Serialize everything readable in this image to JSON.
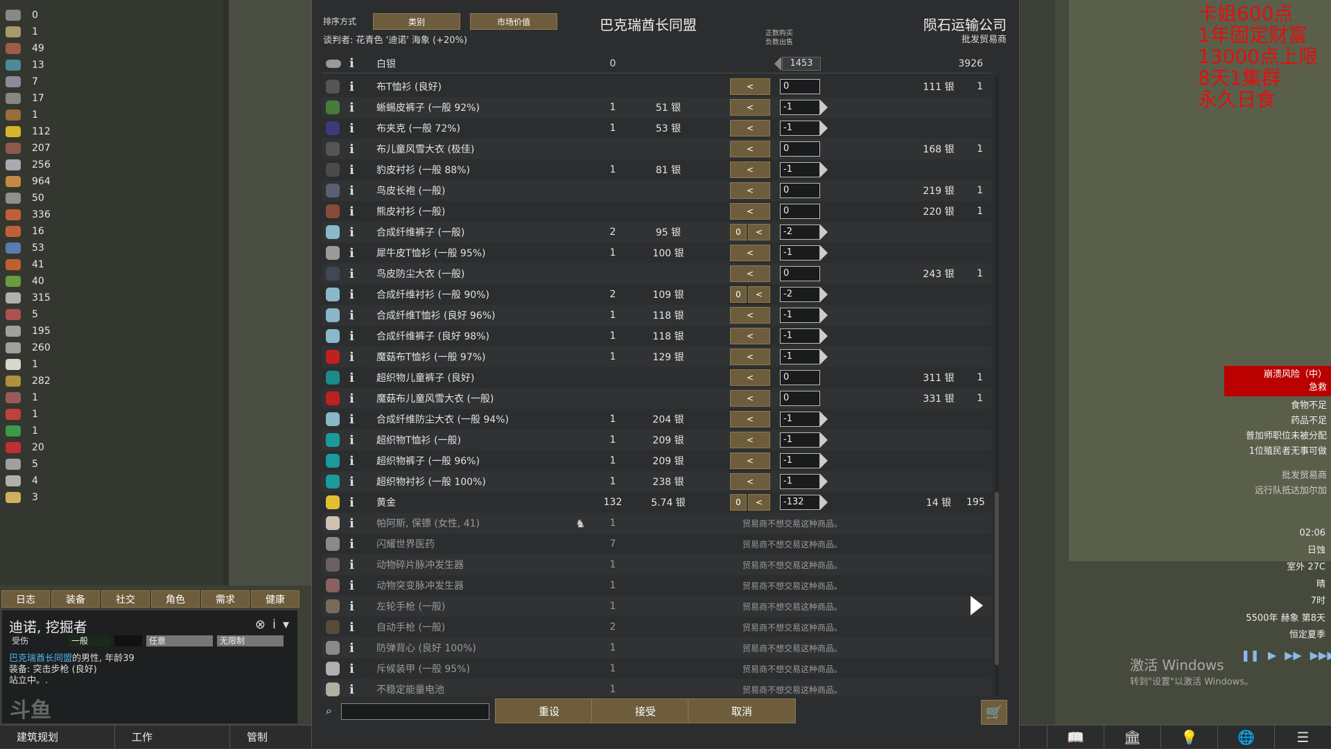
{
  "colors": {
    "accent_button": "#6e5d3c",
    "stream_red": "#e01010",
    "alert_red": "#bb0000",
    "faction_link": "#4fb3e8"
  },
  "resources": [
    {
      "count": "0",
      "color": "#888"
    },
    {
      "count": "1",
      "color": "#a79a6b"
    },
    {
      "count": "49",
      "color": "#9d5b4a"
    },
    {
      "count": "13",
      "color": "#4c8a9b"
    },
    {
      "count": "7",
      "color": "#8b8b9a"
    },
    {
      "count": "17",
      "color": "#8a8580"
    },
    {
      "count": "1",
      "color": "#9a6b3c"
    },
    {
      "count": "112",
      "color": "#d6b42c"
    },
    {
      "count": "207",
      "color": "#8b5a4a"
    },
    {
      "count": "256",
      "color": "#a9a9b0"
    },
    {
      "count": "964",
      "color": "#c28a45"
    },
    {
      "count": "50",
      "color": "#8f8f8f"
    },
    {
      "count": "336",
      "color": "#c0603a"
    },
    {
      "count": "16",
      "color": "#c0603a"
    },
    {
      "count": "53",
      "color": "#5a7ab0"
    },
    {
      "count": "41",
      "color": "#c06030"
    },
    {
      "count": "40",
      "color": "#6a9a40"
    },
    {
      "count": "315",
      "color": "#b0b0b0"
    },
    {
      "count": "5",
      "color": "#b05050"
    },
    {
      "count": "195",
      "color": "#a0a0a0"
    },
    {
      "count": "260",
      "color": "#a0a0a0"
    },
    {
      "count": "1",
      "color": "#d8d8c8"
    },
    {
      "count": "282",
      "color": "#b09040"
    },
    {
      "count": "1",
      "color": "#9a5a5a"
    },
    {
      "count": "1",
      "color": "#c04040"
    },
    {
      "count": "1",
      "color": "#3a9a4a"
    },
    {
      "count": "20",
      "color": "#c03030"
    },
    {
      "count": "5",
      "color": "#a0a0a0"
    },
    {
      "count": "4",
      "color": "#b0b0b0"
    },
    {
      "count": "3",
      "color": "#d0b060"
    }
  ],
  "tabs": [
    "日志",
    "装备",
    "社交",
    "角色",
    "需求",
    "健康"
  ],
  "inspect": {
    "name": "迪诺, 挖掘者",
    "bars": [
      "受伤",
      "一般",
      "任意",
      "无限制"
    ],
    "faction": "巴克瑞酋长同盟",
    "desc_rest": "的男性, 年龄39",
    "equip": "装备: 突击步枪 (良好)",
    "status": "站立中。."
  },
  "logo": "斗鱼",
  "bottombar": {
    "architect": "建筑规划",
    "work": "工作",
    "restrict": "管制"
  },
  "stream_text": [
    "卡姐600点",
    "1年固定财富",
    "13000点上限",
    "8天1集群",
    "永久日食"
  ],
  "alerts": {
    "red": [
      "崩溃风险（中）",
      "急救"
    ],
    "list": [
      "食物不足",
      "药品不足",
      "普加师职位未被分配",
      "1位殖民者无事可做"
    ],
    "list2": [
      "批发贸易商",
      "远行队抵达加尔加"
    ]
  },
  "time": [
    "02:06",
    "日蚀",
    "室外 27C",
    "晴",
    "7时",
    "5500年 赫象 第8天",
    "恒定夏季"
  ],
  "windows_activation": {
    "line1": "激活 Windows",
    "line2": "转到\"设置\"以激活 Windows。"
  },
  "trade": {
    "sort_label": "排序方式",
    "sort_buttons": [
      "类别",
      "市场价值"
    ],
    "negotiator": "谈判者: 花青色 '迪诺' 海象 (+20%)",
    "faction_title": "巴克瑞酋长同盟",
    "trader_title": "陨石运输公司",
    "trader_subtitle": "批发贸易商",
    "buy_sell_hint": [
      "正数购买",
      "负数出售"
    ],
    "silver": {
      "name": "白银",
      "count": "0",
      "balance": "1453",
      "trader_count": "3926"
    },
    "rows": [
      {
        "name": "布T恤衫 (良好)",
        "count": "",
        "price": "",
        "zero": false,
        "qty": "0",
        "arrow": false,
        "tprice": "111 银",
        "tcnt": "1",
        "color": "#555"
      },
      {
        "name": "蜥蜴皮裤子 (一般 92%)",
        "count": "1",
        "price": "51 银",
        "zero": false,
        "qty": "-1",
        "arrow": true,
        "tprice": "",
        "tcnt": "",
        "color": "#4a7a3a"
      },
      {
        "name": "布夹克 (一般 72%)",
        "count": "1",
        "price": "53 银",
        "zero": false,
        "qty": "-1",
        "arrow": true,
        "tprice": "",
        "tcnt": "",
        "color": "#3c3a78"
      },
      {
        "name": "布儿童风雪大衣 (极佳)",
        "count": "",
        "price": "",
        "zero": false,
        "qty": "0",
        "arrow": false,
        "tprice": "168 银",
        "tcnt": "1",
        "color": "#555"
      },
      {
        "name": "豹皮衬衫 (一般 88%)",
        "count": "1",
        "price": "81 银",
        "zero": false,
        "qty": "-1",
        "arrow": true,
        "tprice": "",
        "tcnt": "",
        "color": "#4a4a4a"
      },
      {
        "name": "鸟皮长袍 (一般)",
        "count": "",
        "price": "",
        "zero": false,
        "qty": "0",
        "arrow": false,
        "tprice": "219 银",
        "tcnt": "1",
        "color": "#5a6070"
      },
      {
        "name": "熊皮衬衫 (一般)",
        "count": "",
        "price": "",
        "zero": false,
        "qty": "0",
        "arrow": false,
        "tprice": "220 银",
        "tcnt": "1",
        "color": "#8a4a3a"
      },
      {
        "name": "合成纤维裤子 (一般)",
        "count": "2",
        "price": "95 银",
        "zero": true,
        "qty": "-2",
        "arrow": true,
        "tprice": "",
        "tcnt": "",
        "color": "#8ab8c8"
      },
      {
        "name": "犀牛皮T恤衫 (一般 95%)",
        "count": "1",
        "price": "100 银",
        "zero": false,
        "qty": "-1",
        "arrow": true,
        "tprice": "",
        "tcnt": "",
        "color": "#9a9a9a"
      },
      {
        "name": "鸟皮防尘大衣 (一般)",
        "count": "",
        "price": "",
        "zero": false,
        "qty": "0",
        "arrow": false,
        "tprice": "243 银",
        "tcnt": "1",
        "color": "#404858"
      },
      {
        "name": "合成纤维衬衫 (一般 90%)",
        "count": "2",
        "price": "109 银",
        "zero": true,
        "qty": "-2",
        "arrow": true,
        "tprice": "",
        "tcnt": "",
        "color": "#8ab8c8"
      },
      {
        "name": "合成纤维T恤衫 (良好 96%)",
        "count": "1",
        "price": "118 银",
        "zero": false,
        "qty": "-1",
        "arrow": true,
        "tprice": "",
        "tcnt": "",
        "color": "#8ab8c8"
      },
      {
        "name": "合成纤维裤子 (良好 98%)",
        "count": "1",
        "price": "118 银",
        "zero": false,
        "qty": "-1",
        "arrow": true,
        "tprice": "",
        "tcnt": "",
        "color": "#8ab8c8"
      },
      {
        "name": "魔菇布T恤衫 (一般 97%)",
        "count": "1",
        "price": "129 银",
        "zero": false,
        "qty": "-1",
        "arrow": true,
        "tprice": "",
        "tcnt": "",
        "color": "#c02020"
      },
      {
        "name": "超织物儿童裤子 (良好)",
        "count": "",
        "price": "",
        "zero": false,
        "qty": "0",
        "arrow": false,
        "tprice": "311 银",
        "tcnt": "1",
        "color": "#1a8a8a"
      },
      {
        "name": "魔菇布儿童风雪大衣 (一般)",
        "count": "",
        "price": "",
        "zero": false,
        "qty": "0",
        "arrow": false,
        "tprice": "331 银",
        "tcnt": "1",
        "color": "#c02020"
      },
      {
        "name": "合成纤维防尘大衣 (一般 94%)",
        "count": "1",
        "price": "204 银",
        "zero": false,
        "qty": "-1",
        "arrow": true,
        "tprice": "",
        "tcnt": "",
        "color": "#8ab8c8"
      },
      {
        "name": "超织物T恤衫 (一般)",
        "count": "1",
        "price": "209 银",
        "zero": false,
        "qty": "-1",
        "arrow": true,
        "tprice": "",
        "tcnt": "",
        "color": "#1a9a9a"
      },
      {
        "name": "超织物裤子 (一般 96%)",
        "count": "1",
        "price": "209 银",
        "zero": false,
        "qty": "-1",
        "arrow": true,
        "tprice": "",
        "tcnt": "",
        "color": "#1a9a9a"
      },
      {
        "name": "超织物衬衫 (一般 100%)",
        "count": "1",
        "price": "238 银",
        "zero": false,
        "qty": "-1",
        "arrow": true,
        "tprice": "",
        "tcnt": "",
        "color": "#1a9a9a"
      },
      {
        "name": "黄金",
        "count": "132",
        "price": "5.74 银",
        "zero": true,
        "qty": "-132",
        "arrow": true,
        "tprice": "14 银",
        "tcnt": "195",
        "color": "#e0c030"
      }
    ],
    "untradeable": [
      {
        "name": "帕阿斯, 保镖 (女性, 41)",
        "count": "1",
        "pawn": true,
        "color": "#d0c0b0"
      },
      {
        "name": "闪耀世界医药",
        "count": "7",
        "pawn": false,
        "color": "#8a8a8a"
      },
      {
        "name": "动物碎片脉冲发生器",
        "count": "1",
        "pawn": false,
        "color": "#6a6060"
      },
      {
        "name": "动物突变脉冲发生器",
        "count": "1",
        "pawn": false,
        "color": "#8a6060"
      },
      {
        "name": "左轮手枪 (一般)",
        "count": "1",
        "pawn": false,
        "color": "#7a6a5a"
      },
      {
        "name": "自动手枪 (一般)",
        "count": "2",
        "pawn": false,
        "color": "#5a4a3a"
      },
      {
        "name": "防弹背心 (良好 100%)",
        "count": "1",
        "pawn": false,
        "color": "#8a8a8a"
      },
      {
        "name": "斥候装甲 (一般 95%)",
        "count": "1",
        "pawn": false,
        "color": "#b0b0b0"
      },
      {
        "name": "不稳定能量电池",
        "count": "1",
        "pawn": false,
        "color": "#b0b0a0"
      }
    ],
    "untradeable_note": "贸易商不想交易这种商品。",
    "info_glyph": "i",
    "lt_glyph": "<",
    "zero_label": "0",
    "buttons": {
      "reset": "重设",
      "accept": "接受",
      "cancel": "取消"
    }
  }
}
